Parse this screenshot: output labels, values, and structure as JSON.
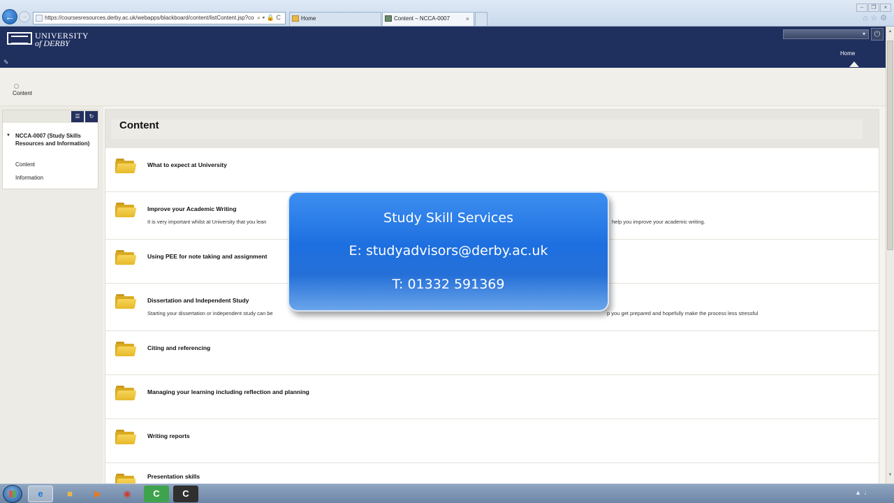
{
  "browser": {
    "url": "https://coursesresources.derby.ac.uk/webapps/blackboard/content/listContent.jsp?co",
    "tabs": [
      {
        "label": "Home"
      },
      {
        "label": "Content – NCCA-0007"
      }
    ],
    "addr_tools": "⌕ ▾ 🔒 C"
  },
  "header": {
    "logo_line1": "UNIVERSITY",
    "logo_line2": "of DERBY",
    "home_tab": "Home"
  },
  "breadcrumb": {
    "label": "Content"
  },
  "sidebar": {
    "course_title": "NCCA-0007 (Study Skills Resources and Information)",
    "links": [
      {
        "label": "Content"
      },
      {
        "label": "Information"
      }
    ]
  },
  "main": {
    "title": "Content",
    "items": [
      {
        "title": "What to expect at University",
        "description": ""
      },
      {
        "title": "Improve your Academic Writing",
        "description": "It is very important whilst at University that you lean"
      },
      {
        "title": "Using PEE for note taking and assignment",
        "description": ""
      },
      {
        "title": "Dissertation and Independent Study",
        "description": "Starting your dissertation or independent study can be"
      },
      {
        "title": "Citing and referencing",
        "description": ""
      },
      {
        "title": "Managing your learning including reflection and planning",
        "description": ""
      },
      {
        "title": "Writing reports",
        "description": ""
      },
      {
        "title": "Presentation skills",
        "description": ""
      }
    ],
    "item2_desc_tail": "help you improve your academic writing.",
    "item4_desc_tail": "p you get prepared and hopefully make the process less stressful"
  },
  "overlay": {
    "line1": "Study Skill Services",
    "line2": "E: studyadvisors@derby.ac.uk",
    "line3": "T: 01332 591369"
  },
  "colors": {
    "header_bg": "#1f2f5e",
    "overlay_blue": "#1d6fe0",
    "folder_yellow": "#e8b92a"
  },
  "icons": [
    "back-icon",
    "forward-icon",
    "folder-icon",
    "power-icon",
    "start-icon",
    "ie-icon",
    "explorer-icon",
    "media-player-icon",
    "chrome-icon",
    "camtasia-icon"
  ]
}
